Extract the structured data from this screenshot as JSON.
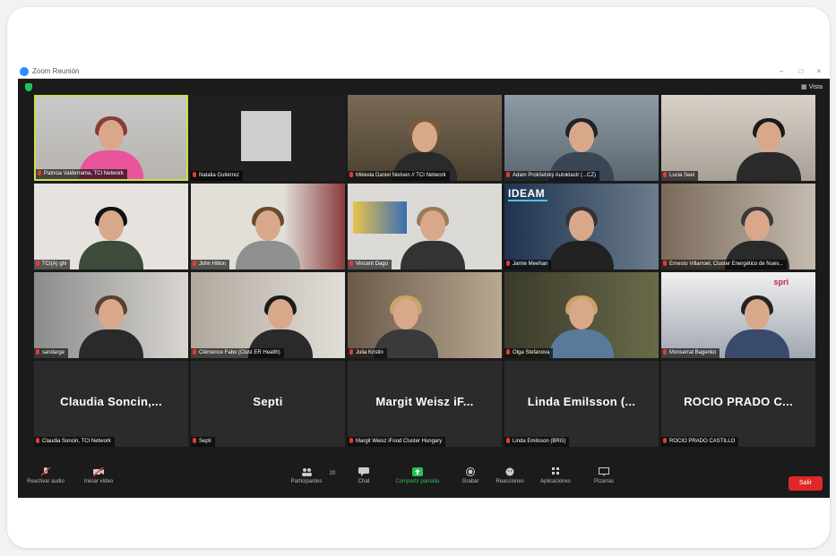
{
  "window": {
    "title": "Zoom Reunión",
    "view_label": "Vista"
  },
  "tiles": [
    {
      "name": "Patricia Valderrama, TCI Network"
    },
    {
      "name": "Natalia Gutiérrez"
    },
    {
      "name": "Mikkela Daniel Nielsen // TCI Network"
    },
    {
      "name": "Adam Prokšelský Autoklastr (...CZ)"
    },
    {
      "name": "Lucia Seel"
    },
    {
      "name": "TCI(A) ghi"
    },
    {
      "name": "John Hilton"
    },
    {
      "name": "Vincent Dago"
    },
    {
      "name": "Jamie Meehan"
    },
    {
      "name": "Ernesto Villarroel, Cluster Energético de Nuev..."
    },
    {
      "name": "sandarge"
    },
    {
      "name": "Clémence Fabo (Clust ER Health)"
    },
    {
      "name": "Julia Kristin"
    },
    {
      "name": "Olga Stefanova"
    },
    {
      "name": "Monserrat Bagenko"
    }
  ],
  "audio_tiles": [
    {
      "big": "Claudia  Soncin,...",
      "name": "Claudia Soncin, TCI Network"
    },
    {
      "big": "Septi",
      "name": "Septi"
    },
    {
      "big": "Margit  Weisz  iF...",
      "name": "Margit Weisz iFood Cluster Hungary"
    },
    {
      "big": "Linda  Emilsson  (...",
      "name": "Linda Emilsson (BRG)"
    },
    {
      "big": "ROCIO  PRADO  C...",
      "name": "ROCIO PRADO CASTILLO"
    }
  ],
  "overlays": {
    "ideam": "IDEAM",
    "spri": "spri"
  },
  "toolbar": {
    "audio": "Reactivar audio",
    "video": "Iniciar vídeo",
    "participants": "Participantes",
    "participants_count": "20",
    "chat": "Chat",
    "share": "Compartir pantalla",
    "record": "Grabar",
    "reactions": "Reacciones",
    "apps": "Aplicaciones",
    "whiteboard": "Pizarras",
    "leave": "Salir"
  },
  "colors": {
    "active_speaker": "#c8e14a",
    "leave": "#e02828",
    "share": "#23c057"
  }
}
